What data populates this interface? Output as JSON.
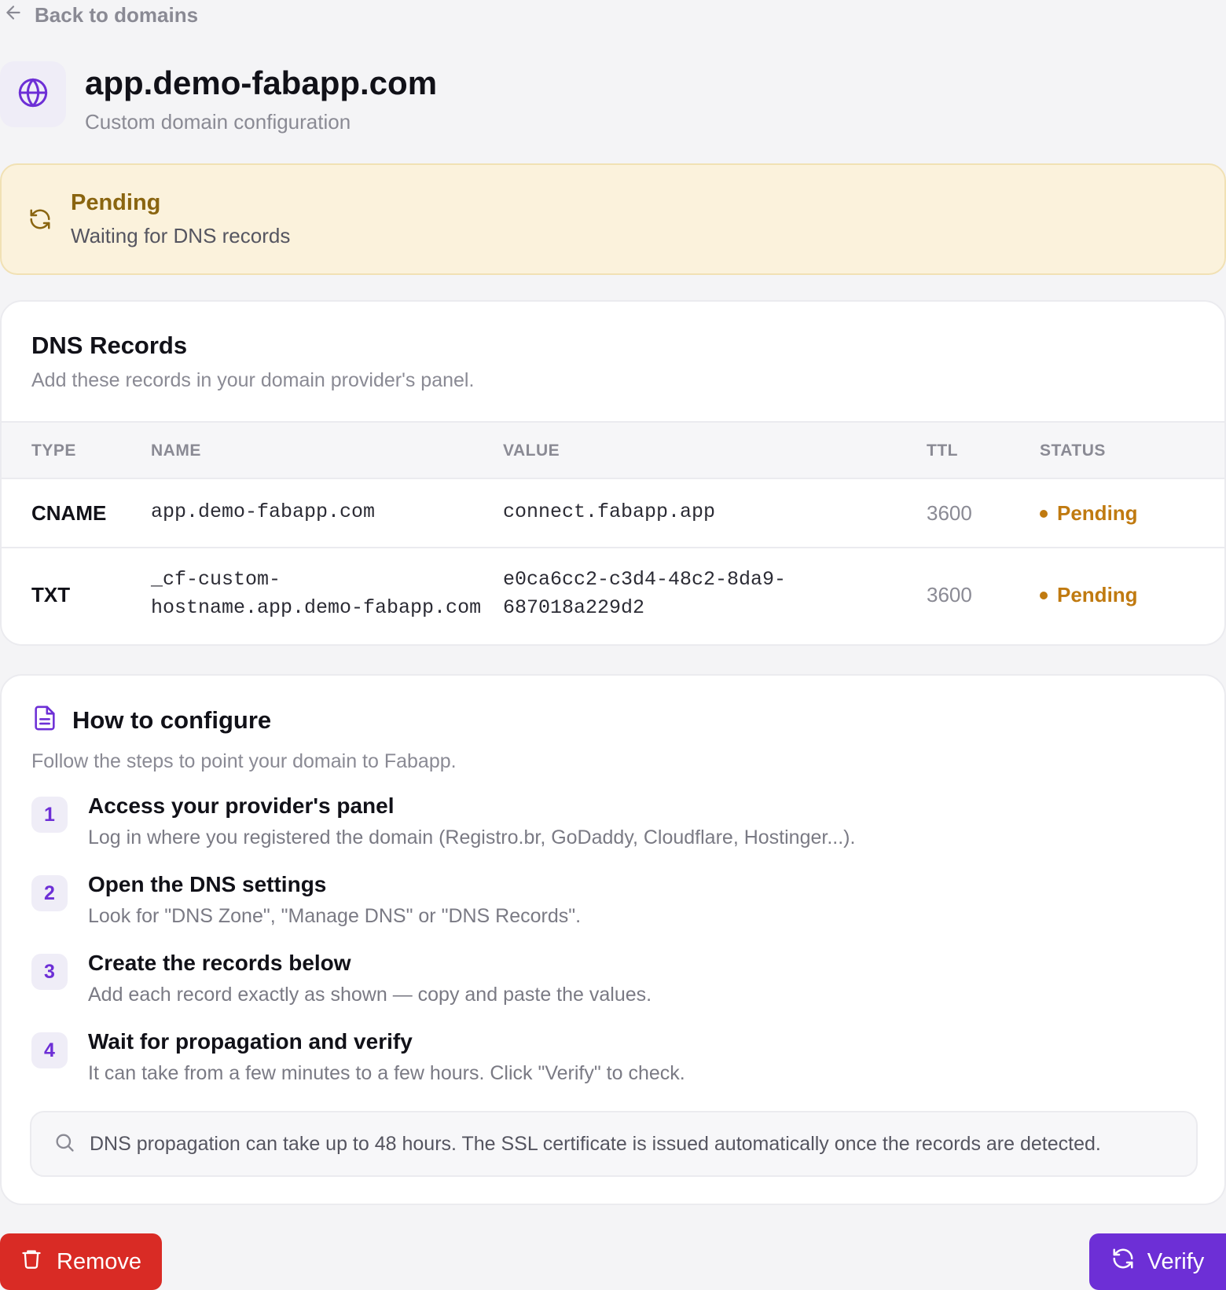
{
  "nav": {
    "back_label": "Back to domains"
  },
  "header": {
    "title": "app.demo-fabapp.com",
    "subtitle": "Custom domain configuration"
  },
  "status": {
    "title": "Pending",
    "description": "Waiting for DNS records",
    "color": "#8a6510",
    "background": "#fbf2dc"
  },
  "dns": {
    "title": "DNS Records",
    "description": "Add these records in your domain provider's panel.",
    "columns": [
      "TYPE",
      "NAME",
      "VALUE",
      "TTL",
      "STATUS"
    ],
    "rows": [
      {
        "type": "CNAME",
        "name_lines": [
          "app.demo-fabapp.com"
        ],
        "value_lines": [
          "connect.fabapp.app"
        ],
        "ttl": "3600",
        "status": "Pending"
      },
      {
        "type": "TXT",
        "name_lines": [
          "_cf-custom-",
          "hostname.app.demo-fabapp.com"
        ],
        "value_lines": [
          "e0ca6cc2-c3d4-48c2-8da9-",
          "687018a229d2"
        ],
        "ttl": "3600",
        "status": "Pending"
      }
    ]
  },
  "how": {
    "title": "How to configure",
    "description": "Follow the steps to point your domain to Fabapp.",
    "steps": [
      {
        "num": "1",
        "title": "Access your provider's panel",
        "desc": "Log in where you registered the domain (Registro.br, GoDaddy, Cloudflare, Hostinger...)."
      },
      {
        "num": "2",
        "title": "Open the DNS settings",
        "desc": "Look for \"DNS Zone\", \"Manage DNS\" or \"DNS Records\"."
      },
      {
        "num": "3",
        "title": "Create the records below",
        "desc": "Add each record exactly as shown — copy and paste the values."
      },
      {
        "num": "4",
        "title": "Wait for propagation and verify",
        "desc": "It can take from a few minutes to a few hours. Click \"Verify\" to check."
      }
    ],
    "note": "DNS propagation can take up to 48 hours. The SSL certificate is issued automatically once the records are detected."
  },
  "actions": {
    "remove_label": "Remove",
    "verify_label": "Verify",
    "remove_color": "#d92b25",
    "verify_color": "#6d2fd6"
  },
  "icons": {
    "back": "arrow-left-icon",
    "domain": "globe-icon",
    "status": "refresh-icon",
    "how": "document-icon",
    "note": "search-icon",
    "remove": "trash-icon",
    "verify": "refresh-icon"
  }
}
